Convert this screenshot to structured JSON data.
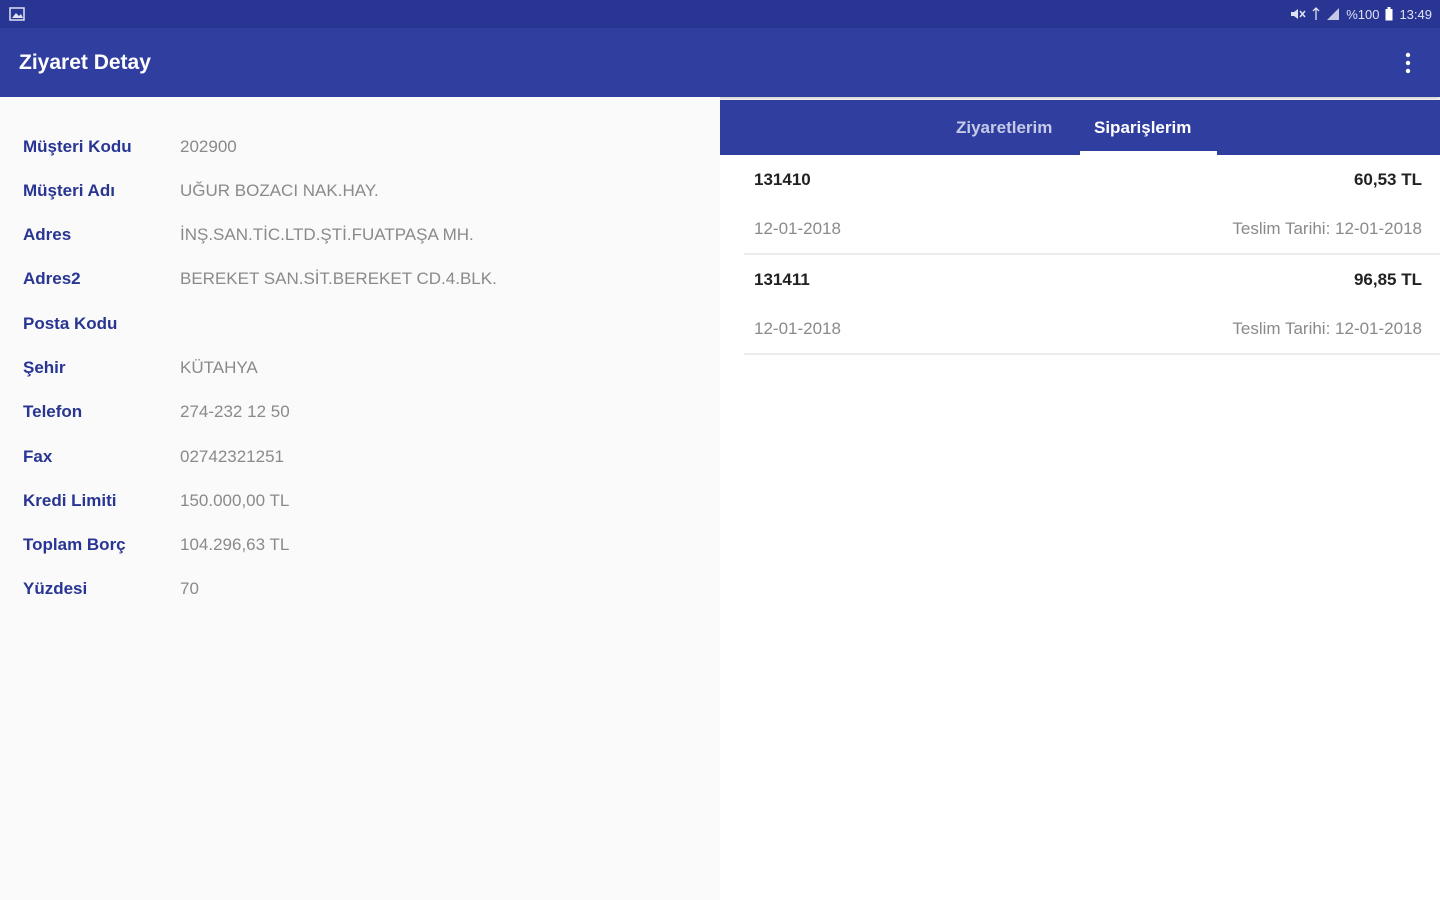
{
  "status_bar": {
    "battery": "%100",
    "time": "13:49"
  },
  "app_bar": {
    "title": "Ziyaret Detay"
  },
  "customer_details": [
    {
      "label": "Müşteri Kodu",
      "value": "202900"
    },
    {
      "label": "Müşteri Adı",
      "value": "UĞUR BOZACI NAK.HAY."
    },
    {
      "label": "Adres",
      "value": "İNŞ.SAN.TİC.LTD.ŞTİ.FUATPAŞA MH."
    },
    {
      "label": "Adres2",
      "value": "BEREKET SAN.SİT.BEREKET CD.4.BLK."
    },
    {
      "label": "Posta Kodu",
      "value": ""
    },
    {
      "label": "Şehir",
      "value": "KÜTAHYA"
    },
    {
      "label": "Telefon",
      "value": "274-232 12 50"
    },
    {
      "label": "Fax",
      "value": "02742321251"
    },
    {
      "label": "Kredi Limiti",
      "value": "150.000,00 TL"
    },
    {
      "label": "Toplam Borç",
      "value": "104.296,63 TL"
    },
    {
      "label": "Yüzdesi",
      "value": "70"
    }
  ],
  "tabs": [
    {
      "label": "Ziyaretlerim",
      "selected": false
    },
    {
      "label": "Siparişlerim",
      "selected": true
    }
  ],
  "orders": [
    {
      "order_no": "131410",
      "amount": "60,53 TL",
      "date": "12-01-2018",
      "delivery": "Teslim Tarihi: 12-01-2018"
    },
    {
      "order_no": "131411",
      "amount": "96,85 TL",
      "date": "12-01-2018",
      "delivery": "Teslim Tarihi: 12-01-2018"
    }
  ],
  "colors": {
    "primary": "#303f9f",
    "primary_dark": "#283593",
    "label": "#283593",
    "muted_text": "#8a8a8a"
  }
}
